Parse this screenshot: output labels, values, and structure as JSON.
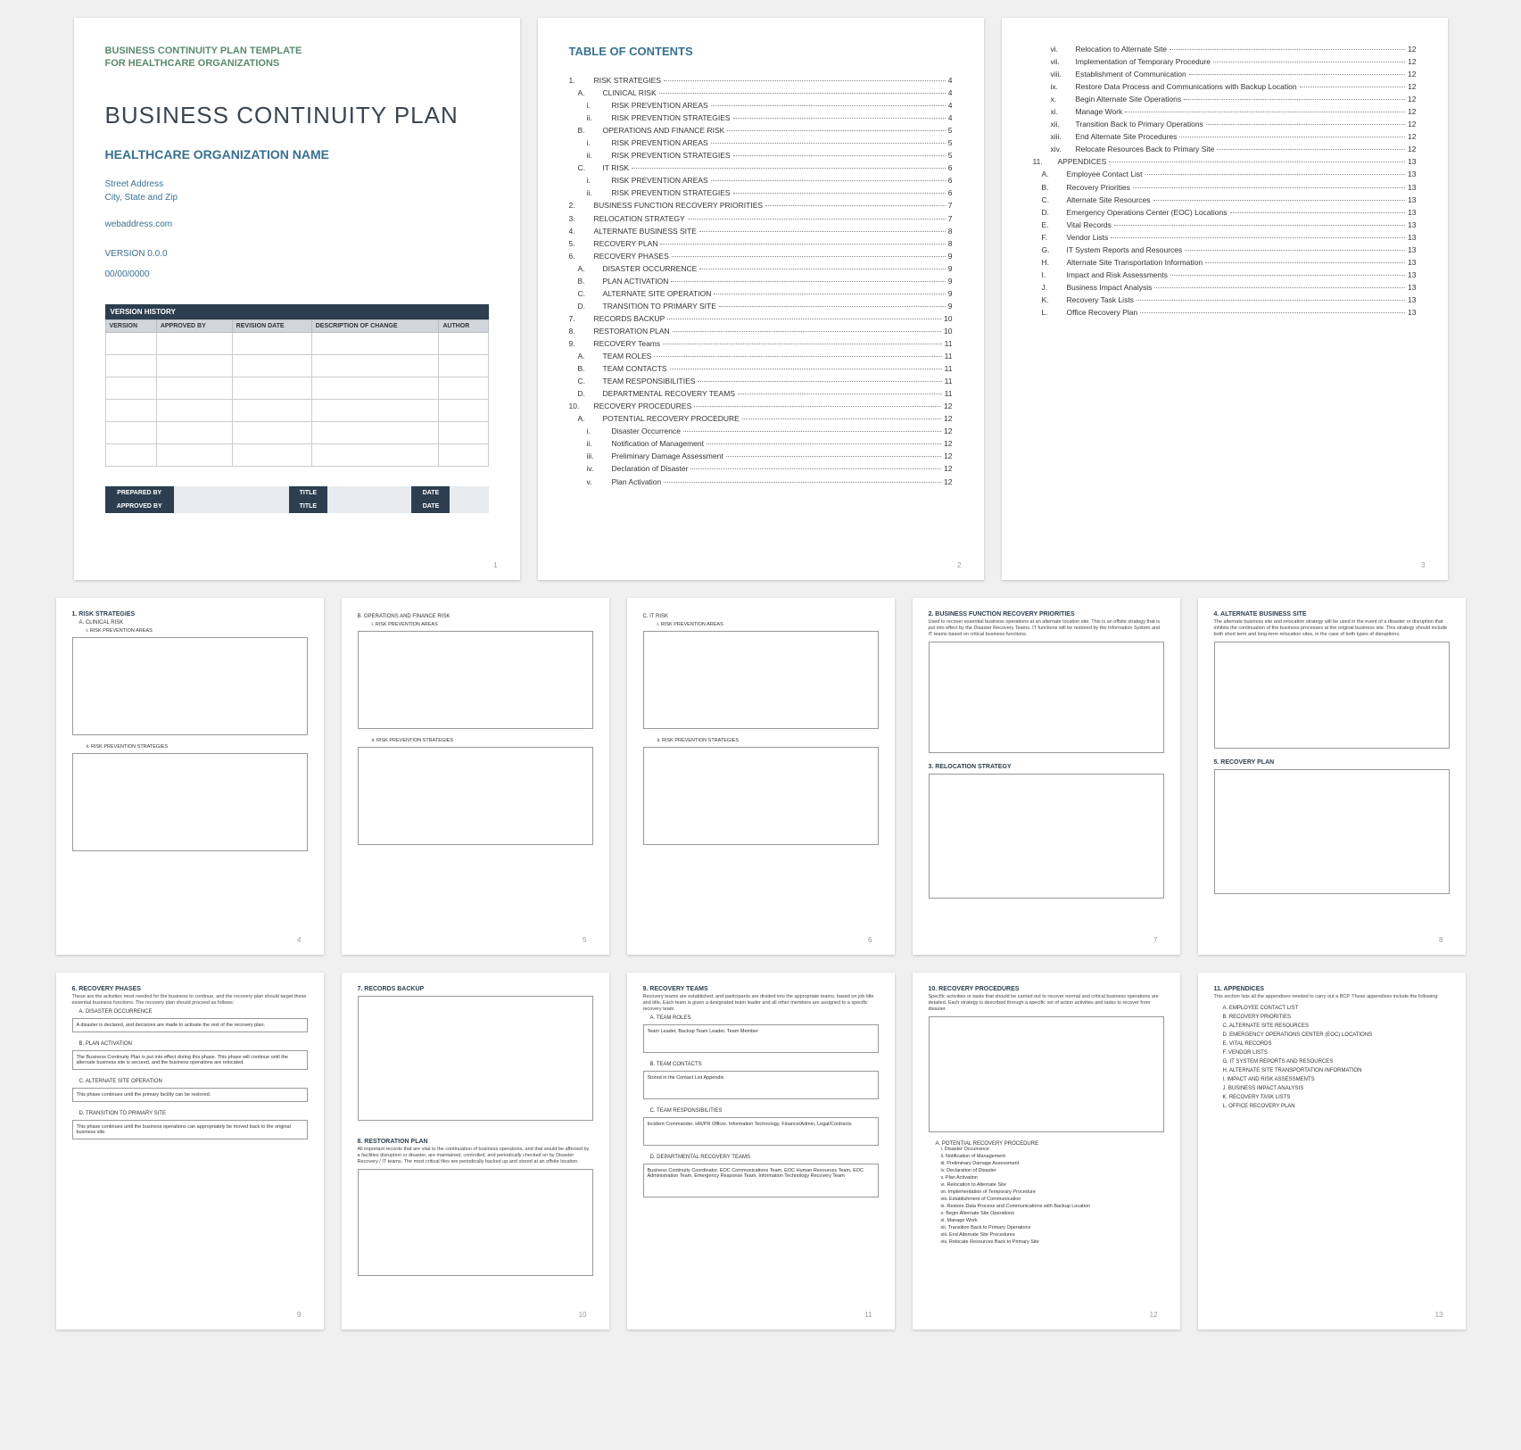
{
  "p1": {
    "header1": "BUSINESS CONTINUITY PLAN TEMPLATE",
    "header2": "FOR HEALTHCARE ORGANIZATIONS",
    "title": "BUSINESS CONTINUITY PLAN",
    "org": "HEALTHCARE ORGANIZATION NAME",
    "addr1": "Street Address",
    "addr2": "City, State and Zip",
    "web": "webaddress.com",
    "version": "VERSION 0.0.0",
    "date": "00/00/0000",
    "vh_title": "VERSION HISTORY",
    "vh_cols": [
      "VERSION",
      "APPROVED BY",
      "REVISION DATE",
      "DESCRIPTION OF CHANGE",
      "AUTHOR"
    ],
    "sig": {
      "prep": "PREPARED BY",
      "appr": "APPROVED BY",
      "title": "TITLE",
      "date": "DATE"
    },
    "num": "1"
  },
  "p2": {
    "title": "TABLE OF CONTENTS",
    "items": [
      {
        "l": 1,
        "n": "1.",
        "t": "RISK STRATEGIES",
        "p": "4"
      },
      {
        "l": 2,
        "n": "A.",
        "t": "CLINICAL RISK",
        "p": "4"
      },
      {
        "l": 3,
        "n": "i.",
        "t": "RISK PREVENTION AREAS",
        "p": "4"
      },
      {
        "l": 3,
        "n": "ii.",
        "t": "RISK PREVENTION STRATEGIES",
        "p": "4"
      },
      {
        "l": 2,
        "n": "B.",
        "t": "OPERATIONS AND FINANCE RISK",
        "p": "5"
      },
      {
        "l": 3,
        "n": "i.",
        "t": "RISK PREVENTION AREAS",
        "p": "5"
      },
      {
        "l": 3,
        "n": "ii.",
        "t": "RISK PREVENTION STRATEGIES",
        "p": "5"
      },
      {
        "l": 2,
        "n": "C.",
        "t": "IT RISK",
        "p": "6"
      },
      {
        "l": 3,
        "n": "i.",
        "t": "RISK PREVENTION AREAS",
        "p": "6"
      },
      {
        "l": 3,
        "n": "ii.",
        "t": "RISK PREVENTION STRATEGIES",
        "p": "6"
      },
      {
        "l": 1,
        "n": "2.",
        "t": "BUSINESS FUNCTION RECOVERY PRIORITIES",
        "p": "7"
      },
      {
        "l": 1,
        "n": "3.",
        "t": "RELOCATION STRATEGY",
        "p": "7"
      },
      {
        "l": 1,
        "n": "4.",
        "t": "ALTERNATE BUSINESS SITE",
        "p": "8"
      },
      {
        "l": 1,
        "n": "5.",
        "t": "RECOVERY PLAN",
        "p": "8"
      },
      {
        "l": 1,
        "n": "6.",
        "t": "RECOVERY PHASES",
        "p": "9"
      },
      {
        "l": 2,
        "n": "A.",
        "t": "DISASTER OCCURRENCE",
        "p": "9"
      },
      {
        "l": 2,
        "n": "B.",
        "t": "PLAN ACTIVATION",
        "p": "9"
      },
      {
        "l": 2,
        "n": "C.",
        "t": "ALTERNATE SITE OPERATION",
        "p": "9"
      },
      {
        "l": 2,
        "n": "D.",
        "t": "TRANSITION TO PRIMARY SITE",
        "p": "9"
      },
      {
        "l": 1,
        "n": "7.",
        "t": "RECORDS BACKUP",
        "p": "10"
      },
      {
        "l": 1,
        "n": "8.",
        "t": "RESTORATION PLAN",
        "p": "10"
      },
      {
        "l": 1,
        "n": "9.",
        "t": "RECOVERY Teams",
        "p": "11"
      },
      {
        "l": 2,
        "n": "A.",
        "t": "TEAM ROLES",
        "p": "11"
      },
      {
        "l": 2,
        "n": "B.",
        "t": "TEAM CONTACTS",
        "p": "11"
      },
      {
        "l": 2,
        "n": "C.",
        "t": "TEAM RESPONSIBILITIES",
        "p": "11"
      },
      {
        "l": 2,
        "n": "D.",
        "t": "DEPARTMENTAL RECOVERY TEAMS",
        "p": "11"
      },
      {
        "l": 1,
        "n": "10.",
        "t": "RECOVERY PROCEDURES",
        "p": "12"
      },
      {
        "l": 2,
        "n": "A.",
        "t": "POTENTIAL RECOVERY PROCEDURE",
        "p": "12"
      },
      {
        "l": 3,
        "n": "i.",
        "t": "Disaster Occurrence",
        "p": "12"
      },
      {
        "l": 3,
        "n": "ii.",
        "t": "Notification of Management",
        "p": "12"
      },
      {
        "l": 3,
        "n": "iii.",
        "t": "Preliminary Damage Assessment",
        "p": "12"
      },
      {
        "l": 3,
        "n": "iv.",
        "t": "Declaration of Disaster",
        "p": "12"
      },
      {
        "l": 3,
        "n": "v.",
        "t": "Plan Activation",
        "p": "12"
      }
    ],
    "num": "2"
  },
  "p3": {
    "items": [
      {
        "l": 3,
        "n": "vi.",
        "t": "Relocation to Alternate Site",
        "p": "12"
      },
      {
        "l": 3,
        "n": "vii.",
        "t": "Implementation of Temporary Procedure",
        "p": "12"
      },
      {
        "l": 3,
        "n": "viii.",
        "t": "Establishment of Communication",
        "p": "12"
      },
      {
        "l": 3,
        "n": "ix.",
        "t": "Restore Data Process and Communications with Backup Location",
        "p": "12"
      },
      {
        "l": 3,
        "n": "x.",
        "t": "Begin Alternate Site Operations",
        "p": "12"
      },
      {
        "l": 3,
        "n": "xi.",
        "t": "Manage Work",
        "p": "12"
      },
      {
        "l": 3,
        "n": "xii.",
        "t": "Transition Back to Primary Operations",
        "p": "12"
      },
      {
        "l": 3,
        "n": "xiii.",
        "t": "End Alternate Site Procedures",
        "p": "12"
      },
      {
        "l": 3,
        "n": "xiv.",
        "t": "Relocate Resources Back to Primary Site",
        "p": "12"
      },
      {
        "l": 1,
        "n": "11.",
        "t": "APPENDICES",
        "p": "13"
      },
      {
        "l": 2,
        "n": "A.",
        "t": "Employee Contact List",
        "p": "13"
      },
      {
        "l": 2,
        "n": "B.",
        "t": "Recovery Priorities",
        "p": "13"
      },
      {
        "l": 2,
        "n": "C.",
        "t": "Alternate Site Resources",
        "p": "13"
      },
      {
        "l": 2,
        "n": "D.",
        "t": "Emergency Operations Center (EOC) Locations",
        "p": "13"
      },
      {
        "l": 2,
        "n": "E.",
        "t": "Vital Records",
        "p": "13"
      },
      {
        "l": 2,
        "n": "F.",
        "t": "Vendor Lists",
        "p": "13"
      },
      {
        "l": 2,
        "n": "G.",
        "t": "IT System Reports and Resources",
        "p": "13"
      },
      {
        "l": 2,
        "n": "H.",
        "t": "Alternate Site Transportation Information",
        "p": "13"
      },
      {
        "l": 2,
        "n": "I.",
        "t": "Impact and Risk Assessments",
        "p": "13"
      },
      {
        "l": 2,
        "n": "J.",
        "t": "Business Impact Analysis",
        "p": "13"
      },
      {
        "l": 2,
        "n": "K.",
        "t": "Recovery Task Lists",
        "p": "13"
      },
      {
        "l": 2,
        "n": "L.",
        "t": "Office Recovery Plan",
        "p": "13"
      }
    ],
    "num": "3"
  },
  "p4": {
    "title": "1. RISK STRATEGIES",
    "sub": "A. CLINICAL RISK",
    "s1": "i. RISK PREVENTION AREAS",
    "s2": "ii. RISK PREVENTION STRATEGIES",
    "num": "4"
  },
  "p5": {
    "sub": "B. OPERATIONS AND FINANCE RISK",
    "s1": "i. RISK PREVENTION AREAS",
    "s2": "ii. RISK PREVENTION STRATEGIES",
    "num": "5"
  },
  "p6": {
    "sub": "C. IT RISK",
    "s1": "i. RISK PREVENTION AREAS",
    "s2": "ii. RISK PREVENTION STRATEGIES",
    "num": "6"
  },
  "p7": {
    "t1": "2. BUSINESS FUNCTION RECOVERY PRIORITIES",
    "d1": "Used to recover essential business operations at an alternate location site. This is an offsite strategy that is put into effect by the Disaster Recovery Teams. IT functions will be restored by the Information System and IT teams based on critical business functions.",
    "t2": "3. RELOCATION STRATEGY",
    "num": "7"
  },
  "p8": {
    "t1": "4. ALTERNATE BUSINESS SITE",
    "d1": "The alternate business site and relocation strategy will be used in the event of a disaster or disruption that inhibits the continuation of the business processes at the original business site. This strategy should include both short term and long-term relocation sites, in the case of both types of disruptions.",
    "t2": "5. RECOVERY PLAN",
    "num": "8"
  },
  "p9": {
    "title": "6. RECOVERY PHASES",
    "desc": "These are the activities most needed for the business to continue, and the recovery plan should target these essential business functions. The recovery plan should proceed as follows:",
    "a": "A. DISASTER OCCURRENCE",
    "at": "A disaster is declared, and decisions are made to activate the rest of the recovery plan.",
    "b": "B. PLAN ACTIVATION",
    "bt": "The Business Continuity Plan is put into effect during this phase. This phase will continue until the alternate business site is secured, and the business operations are relocated.",
    "c": "C. ALTERNATE SITE OPERATION",
    "ct": "This phase continues until the primary facility can be restored.",
    "d": "D. TRANSITION TO PRIMARY SITE",
    "dt": "This phase continues until the business operations can appropriately be moved back to the original business site.",
    "num": "9"
  },
  "p10": {
    "t1": "7. RECORDS BACKUP",
    "t2": "8. RESTORATION PLAN",
    "d2": "All important records that are vital to the continuation of business operations, and that would be affected by a facilities disruption or disaster, are maintained, controlled, and periodically checked on by Disaster Recovery / IT teams. The most critical files are periodically backed up and stored at an offsite location.",
    "num": "10"
  },
  "p11": {
    "title": "9. RECOVERY TEAMS",
    "desc": "Recovery teams are established, and participants are divided into the appropriate teams, based on job title and title. Each team is given a designated team leader and all other members are assigned to a specific recovery team.",
    "a": "A. TEAM ROLES",
    "at": "Team Leader, Backup Team Leader, Team Member",
    "b": "B. TEAM CONTACTS",
    "bt": "Stored in the Contact List Appendix",
    "c": "C. TEAM RESPONSIBILITIES",
    "ct": "Incident Commander, HR/PR Officer, Information Technology, Finance/Admin, Legal/Contracts",
    "d": "D. DEPARTMENTAL RECOVERY TEAMS",
    "dt": "Business Continuity Coordinator, EOC Communications Team, EOC Human Resources Team, EOC Administration Team, Emergency Response Team, Information Technology Recovery Team",
    "num": "11"
  },
  "p12": {
    "title": "10. RECOVERY PROCEDURES",
    "desc": "Specific activities or tasks that should be carried out to recover normal and critical business operations are detailed. Each strategy is described through a specific set of action activities and tasks to recover from disaster.",
    "sub": "A. POTENTIAL RECOVERY PROCEDURE",
    "items": [
      "i. Disaster Occurrence",
      "ii. Notification of Management",
      "iii. Preliminary Damage Assessment",
      "iv. Declaration of Disaster",
      "v. Plan Activation",
      "vi. Relocation to Alternate Site",
      "vii. Implementation of Temporary Procedure",
      "viii. Establishment of Communication",
      "ix. Restore Data Process and Communications with Backup Location",
      "x. Begin Alternate Site Operations",
      "xi. Manage Work",
      "xii. Transition Back to Primary Operations",
      "xiii. End Alternate Site Procedures",
      "xiv. Relocate Resources Back to Primary Site"
    ],
    "num": "12"
  },
  "p13": {
    "title": "11. APPENDICES",
    "desc": "This section lists all the appendixes needed to carry out a BCP. These appendixes include the following:",
    "items": [
      "A. EMPLOYEE CONTACT LIST",
      "B. RECOVERY PRIORITIES",
      "C. ALTERNATE SITE RESOURCES",
      "D. EMERGENCY OPERATIONS CENTER (EOC) LOCATIONS",
      "E. VITAL RECORDS",
      "F. VENDOR LISTS",
      "G. IT SYSTEM REPORTS AND RESOURCES",
      "H. ALTERNATE SITE TRANSPORTATION INFORMATION",
      "I. IMPACT AND RISK ASSESSMENTS",
      "J. BUSINESS IMPACT ANALYSIS",
      "K. RECOVERY TASK LISTS",
      "L. OFFICE RECOVERY PLAN"
    ],
    "num": "13"
  }
}
